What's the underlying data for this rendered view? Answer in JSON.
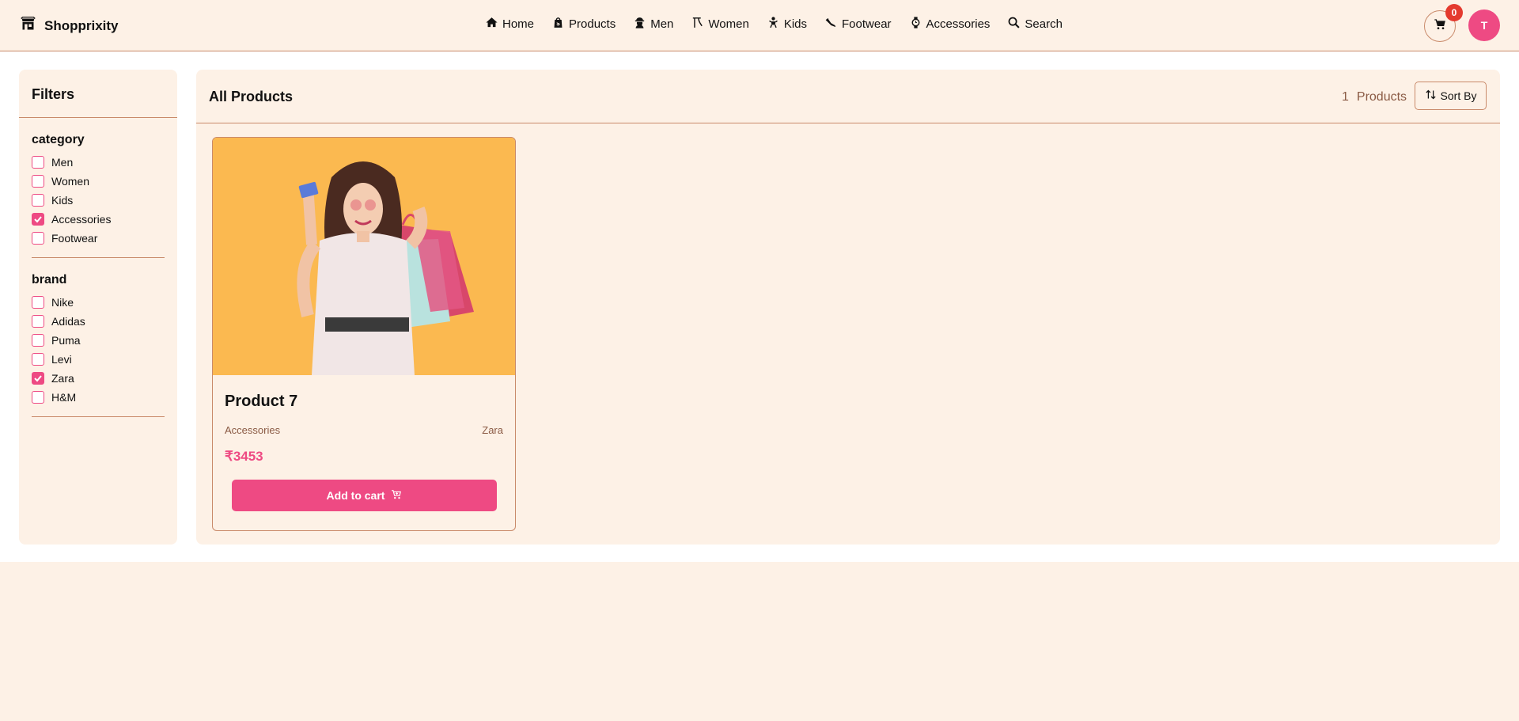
{
  "header": {
    "brand": "Shopprixity",
    "brand_icon": "store-icon",
    "nav": [
      {
        "label": "Home",
        "icon": "home-icon"
      },
      {
        "label": "Products",
        "icon": "shopping-bag-icon"
      },
      {
        "label": "Men",
        "icon": "man-icon"
      },
      {
        "label": "Women",
        "icon": "woman-icon"
      },
      {
        "label": "Kids",
        "icon": "baby-icon"
      },
      {
        "label": "Footwear",
        "icon": "shoe-icon"
      },
      {
        "label": "Accessories",
        "icon": "watch-icon"
      },
      {
        "label": "Search",
        "icon": "search-icon"
      }
    ],
    "cart_count": "0",
    "avatar_initial": "T"
  },
  "filters": {
    "title": "Filters",
    "groups": [
      {
        "title": "category",
        "options": [
          {
            "label": "Men",
            "checked": false
          },
          {
            "label": "Women",
            "checked": false
          },
          {
            "label": "Kids",
            "checked": false
          },
          {
            "label": "Accessories",
            "checked": true
          },
          {
            "label": "Footwear",
            "checked": false
          }
        ]
      },
      {
        "title": "brand",
        "options": [
          {
            "label": "Nike",
            "checked": false
          },
          {
            "label": "Adidas",
            "checked": false
          },
          {
            "label": "Puma",
            "checked": false
          },
          {
            "label": "Levi",
            "checked": false
          },
          {
            "label": "Zara",
            "checked": true
          },
          {
            "label": "H&M",
            "checked": false
          }
        ]
      }
    ]
  },
  "main": {
    "title": "All Products",
    "count_number": "1",
    "count_label": "Products",
    "sort_label": "Sort By",
    "products": [
      {
        "name": "Product 7",
        "category": "Accessories",
        "brand": "Zara",
        "price": "₹3453",
        "add_label": "Add to cart"
      }
    ]
  },
  "colors": {
    "accent": "#ee4a83",
    "background": "#fdf1e6",
    "border": "#c98a6a",
    "badge": "#e43a2e",
    "image_bg": "#fbb950"
  }
}
